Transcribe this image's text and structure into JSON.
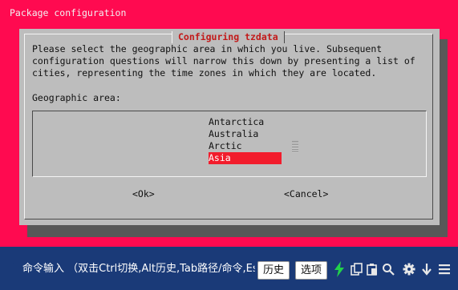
{
  "background_title": "Package configuration",
  "dialog": {
    "title": "Configuring tzdata",
    "prompt_lines": [
      "Please select the geographic area in which you live. Subsequent",
      "configuration questions will narrow this down by presenting a list of",
      "cities, representing the time zones in which they are located."
    ],
    "list_label": "Geographic area:",
    "options": [
      "Antarctica",
      "Australia",
      "Arctic",
      "Asia"
    ],
    "selected": "Asia",
    "ok_label": "<Ok>",
    "cancel_label": "<Cancel>"
  },
  "command_bar": {
    "input_text": "命令输入 （双击Ctrl切换,Alt历史,Tab路径/命令,Esc",
    "history_label": "历史",
    "options_label": "选项",
    "icons": [
      "lightning-icon",
      "copy-icon",
      "paste-icon",
      "search-icon",
      "gear-icon",
      "download-icon",
      "menu-icon"
    ]
  },
  "colors": {
    "terminal_bg": "#ff0a50",
    "dialog_bg": "#bdbdbd",
    "selection": "#f21c2c",
    "title_text": "#c21a1a",
    "app_bg": "#1a3a78"
  }
}
